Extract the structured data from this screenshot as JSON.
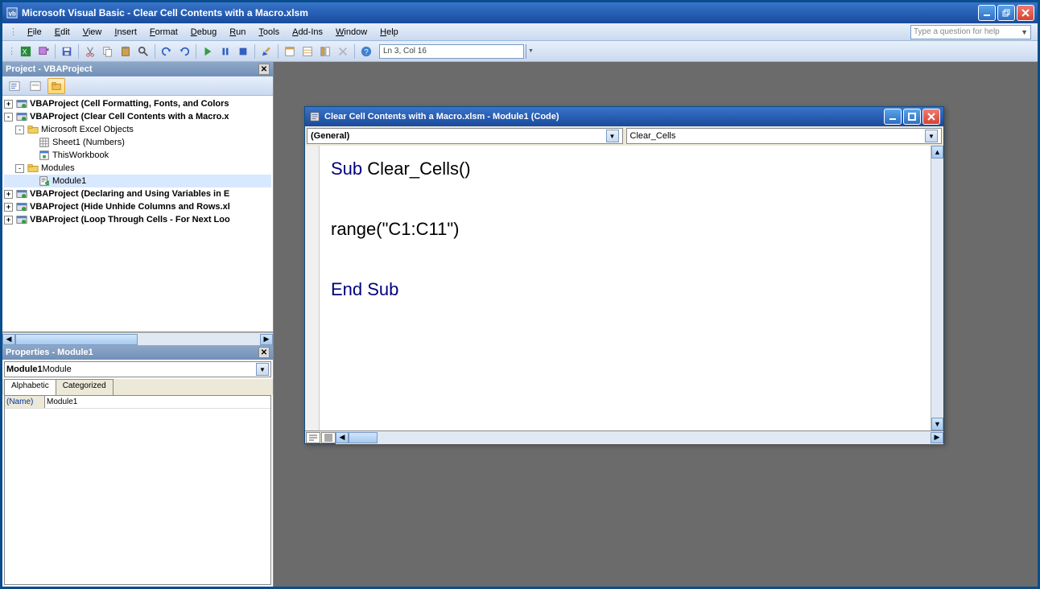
{
  "titlebar": {
    "title": "Microsoft Visual Basic - Clear Cell Contents with a Macro.xlsm"
  },
  "menu": {
    "items": [
      "File",
      "Edit",
      "View",
      "Insert",
      "Format",
      "Debug",
      "Run",
      "Tools",
      "Add-Ins",
      "Window",
      "Help"
    ]
  },
  "helpbox": {
    "placeholder": "Type a question for help"
  },
  "toolbar": {
    "position": "Ln 3, Col 16"
  },
  "project": {
    "title": "Project - VBAProject",
    "nodes": [
      {
        "indent": 0,
        "expand": "+",
        "icon": "vba",
        "label": "VBAProject (Cell Formatting, Fonts, and Colors",
        "bold": true
      },
      {
        "indent": 0,
        "expand": "-",
        "icon": "vba",
        "label": "VBAProject (Clear Cell Contents with a Macro.x",
        "bold": true
      },
      {
        "indent": 1,
        "expand": "-",
        "icon": "folder",
        "label": "Microsoft Excel Objects",
        "bold": false
      },
      {
        "indent": 2,
        "expand": "",
        "icon": "sheet",
        "label": "Sheet1 (Numbers)",
        "bold": false
      },
      {
        "indent": 2,
        "expand": "",
        "icon": "book",
        "label": "ThisWorkbook",
        "bold": false
      },
      {
        "indent": 1,
        "expand": "-",
        "icon": "folder",
        "label": "Modules",
        "bold": false
      },
      {
        "indent": 2,
        "expand": "",
        "icon": "module",
        "label": "Module1",
        "bold": false,
        "selected": true
      },
      {
        "indent": 0,
        "expand": "+",
        "icon": "vba",
        "label": "VBAProject (Declaring and Using Variables in E",
        "bold": true
      },
      {
        "indent": 0,
        "expand": "+",
        "icon": "vba",
        "label": "VBAProject (Hide Unhide Columns and Rows.xl",
        "bold": true
      },
      {
        "indent": 0,
        "expand": "+",
        "icon": "vba",
        "label": "VBAProject (Loop Through Cells - For Next Loo",
        "bold": true
      }
    ]
  },
  "properties": {
    "title": "Properties - Module1",
    "combo_bold": "Module1",
    "combo_rest": " Module",
    "tabs": [
      "Alphabetic",
      "Categorized"
    ],
    "rows": [
      {
        "name": "(Name)",
        "value": "Module1"
      }
    ]
  },
  "codewin": {
    "title": "Clear Cell Contents with a Macro.xlsm - Module1 (Code)",
    "combo_left": "(General)",
    "combo_right": "Clear_Cells",
    "code_tokens": [
      {
        "t": "Sub",
        "kw": true
      },
      {
        "t": " Clear_Cells()\n",
        "kw": false
      },
      {
        "t": "\nrange(\"C1:C11\")\n\n",
        "kw": false
      },
      {
        "t": "End Sub",
        "kw": true
      }
    ]
  }
}
